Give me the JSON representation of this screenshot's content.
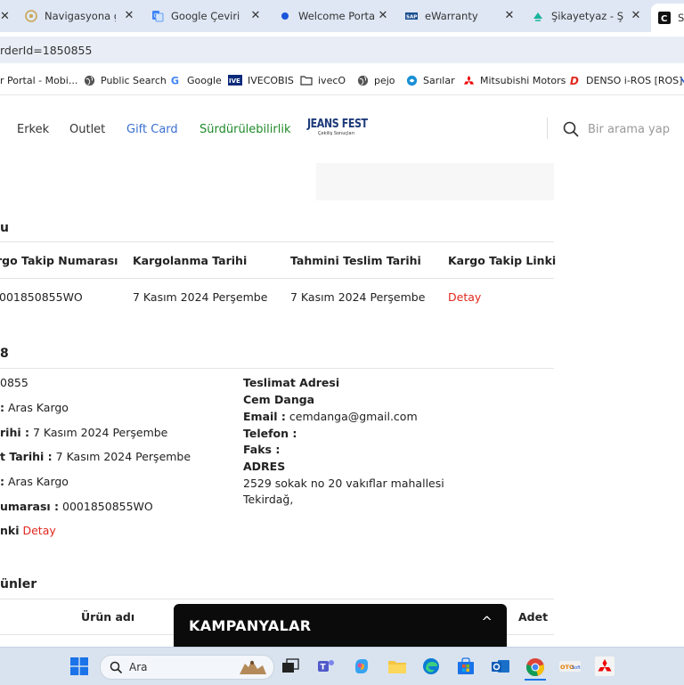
{
  "browser": {
    "tabs": [
      {
        "label": "Navigasyona gö",
        "icon": "navigation-site-icon"
      },
      {
        "label": "Google Çeviri",
        "icon": "google-translate-icon"
      },
      {
        "label": "Welcome Portal",
        "icon": "portal-dot-icon"
      },
      {
        "label": "eWarranty",
        "icon": "sap-icon"
      },
      {
        "label": "Şikayetyaz - Şika",
        "icon": "sikayetyaz-icon"
      },
      {
        "label": "Si",
        "icon": "c-site-icon"
      }
    ],
    "url": "rderId=1850855",
    "bookmarks": [
      {
        "label": "r Portal - Mobi...",
        "icon": "none"
      },
      {
        "label": "Public Search",
        "icon": "globe-icon"
      },
      {
        "label": "Google",
        "icon": "google-icon"
      },
      {
        "label": "IVECOBIS",
        "icon": "iveco-icon"
      },
      {
        "label": "ivecO",
        "icon": "folder-icon"
      },
      {
        "label": "pejo",
        "icon": "globe-icon"
      },
      {
        "label": "Sarılar",
        "icon": "sarilar-icon"
      },
      {
        "label": "Mitsubishi Motors",
        "icon": "mitsubishi-icon"
      },
      {
        "label": "DENSO i-ROS [ROS]",
        "icon": "denso-icon"
      }
    ]
  },
  "nav": {
    "items": [
      "Erkek",
      "Outlet",
      "Gift Card",
      "Sürdürülebilirlik"
    ],
    "logo_text": "JEANS FEST",
    "logo_sub": "Çekiliş Sonuçları",
    "search_placeholder": "Bir arama yap"
  },
  "shipping": {
    "title": "u",
    "headers": [
      "rgo Takip Numarası",
      "Kargolanma Tarihi",
      "Tahmini Teslim Tarihi",
      "Kargo Takip Linki"
    ],
    "row": {
      "tracking": "001850855WO",
      "shipped": "7 Kasım 2024 Perşembe",
      "estimated": "7 Kasım 2024 Perşembe",
      "link": "Detay"
    }
  },
  "order": {
    "title": "8",
    "lines": [
      {
        "label": "",
        "value": "0855"
      },
      {
        "label": ":",
        "value": " Aras Kargo"
      },
      {
        "label": "rihi :",
        "value": " 7 Kasım 2024 Perşembe"
      },
      {
        "label": "t Tarihi :",
        "value": " 7 Kasım 2024 Perşembe"
      },
      {
        "label": ":",
        "value": " Aras Kargo"
      },
      {
        "label": "umarası :",
        "value": " 0001850855WO"
      }
    ],
    "link_label": "nki",
    "link_text": " Detay"
  },
  "delivery": {
    "heading": "Teslimat Adresi",
    "name": "Cem Danga",
    "email_label": "Email :",
    "email": " cemdanga@gmail.com",
    "phone_label": "Telefon :",
    "fax_label": "Faks :",
    "address_label": "ADRES",
    "address_line1": "2529 sokak no 20 vakıflar mahallesi",
    "address_line2": "Tekirdağ,"
  },
  "products": {
    "title": "ünler",
    "col_name": "Ürün adı",
    "col_qty": "Adet"
  },
  "campaign": {
    "title": "KAMPANYALAR",
    "caret": "^"
  },
  "taskbar": {
    "search_placeholder": "Ara"
  }
}
